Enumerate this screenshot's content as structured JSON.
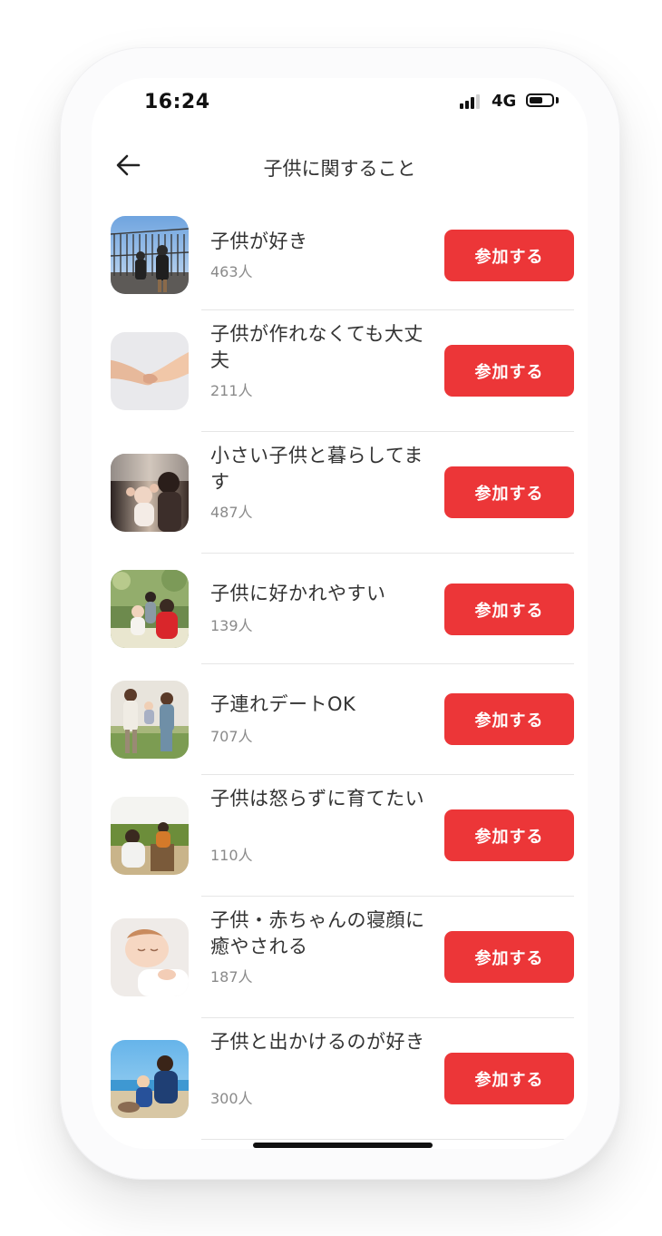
{
  "status_bar": {
    "time": "16:24",
    "network": "4G",
    "signal_icon": "cellular-signal-icon",
    "battery_icon": "battery-icon",
    "battery_level": 0.6
  },
  "header": {
    "back_icon": "arrow-left-icon",
    "title": "子供に関すること"
  },
  "join_label": "参加する",
  "groups": [
    {
      "title": "子供が好き",
      "count": "463人",
      "thumb": "two-children-at-railing-photo"
    },
    {
      "title": "子供が作れなくても大丈夫",
      "count": "211人",
      "thumb": "holding-hands-photo"
    },
    {
      "title": "小さい子供と暮らしてます",
      "count": "487人",
      "thumb": "parent-and-baby-photo"
    },
    {
      "title": "子供に好かれやすい",
      "count": "139人",
      "thumb": "adults-with-toddler-photo"
    },
    {
      "title": "子連れデートOK",
      "count": "707人",
      "thumb": "family-in-field-photo"
    },
    {
      "title": "子供は怒らずに育てたい",
      "count": "110人",
      "thumb": "father-with-child-photo"
    },
    {
      "title": "子供・赤ちゃんの寝顔に癒やされる",
      "count": "187人",
      "thumb": "sleeping-baby-photo"
    },
    {
      "title": "子供と出かけるのが好き",
      "count": "300人",
      "thumb": "mother-and-child-at-beach-photo"
    }
  ]
}
